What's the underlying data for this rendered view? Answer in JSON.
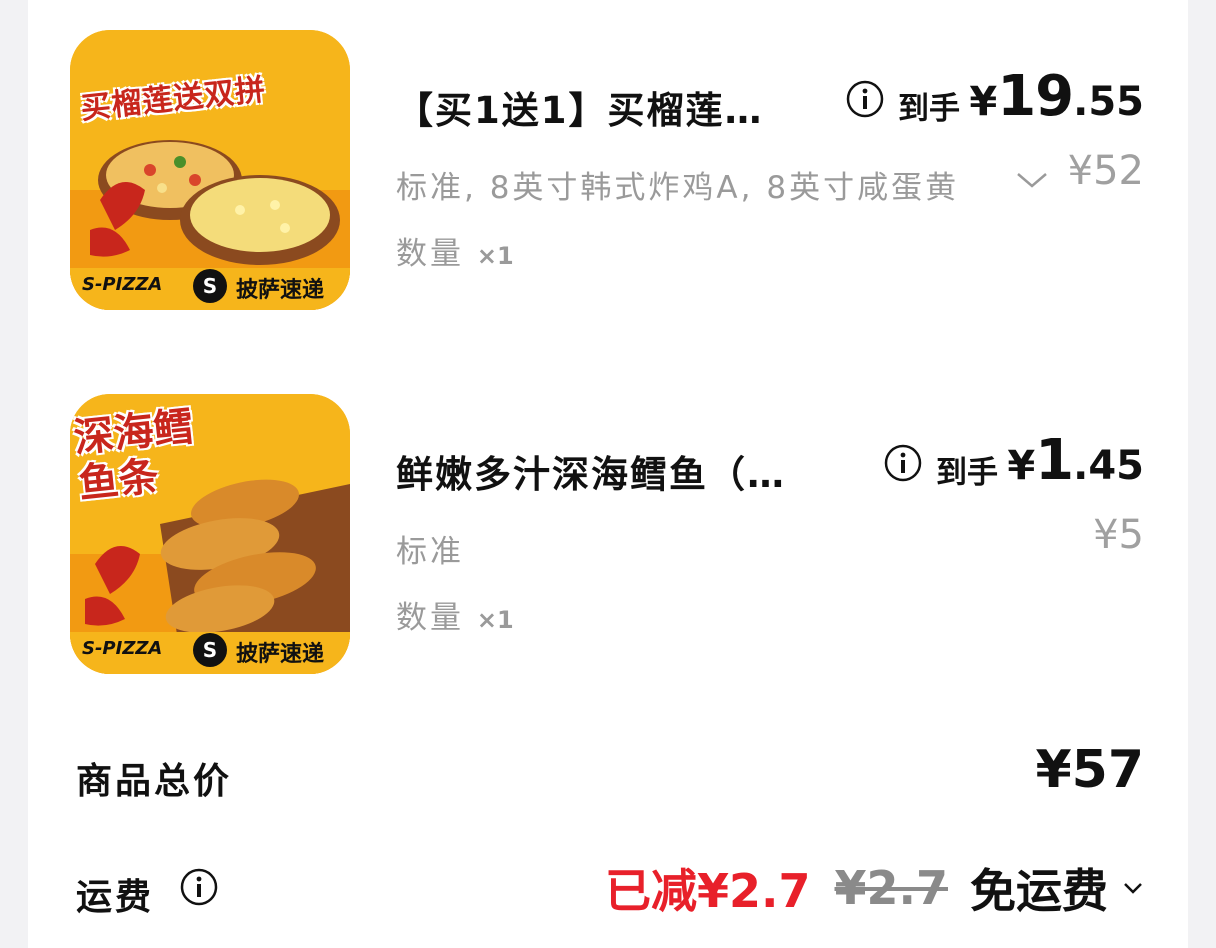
{
  "items": [
    {
      "image_title": "买榴莲送双拼",
      "image_brand": "S-PIZZA",
      "image_brand_cn": "披萨速递",
      "name": "【买1送1】买榴莲…",
      "daoshou_label": "到手",
      "price_yen": "¥",
      "price_int": "19",
      "price_dec": ".55",
      "spec": "标准, 8英寸韩式炸鸡A, 8英寸咸蛋黄",
      "has_spec_dropdown": true,
      "orig_price": "¥52",
      "qty_label": "数量",
      "qty_value": "×1"
    },
    {
      "image_title": "深海鳕鱼条",
      "image_brand": "S-PIZZA",
      "image_brand_cn": "披萨速递",
      "name": "鲜嫩多汁深海鳕鱼（…",
      "daoshou_label": "到手",
      "price_yen": "¥",
      "price_int": "1",
      "price_dec": ".45",
      "spec": "标准",
      "has_spec_dropdown": false,
      "orig_price": "¥5",
      "qty_label": "数量",
      "qty_value": "×1"
    }
  ],
  "summary": {
    "total_label": "商品总价",
    "total_value": "¥57",
    "shipping_label": "运费",
    "shipping_discount": "已减¥2.7",
    "shipping_original": "¥2.7",
    "shipping_final": "免运费"
  },
  "colors": {
    "accent_red": "#e8202a",
    "muted_gray": "#9a9a9a",
    "thumb_yellow": "#f6b51b"
  }
}
